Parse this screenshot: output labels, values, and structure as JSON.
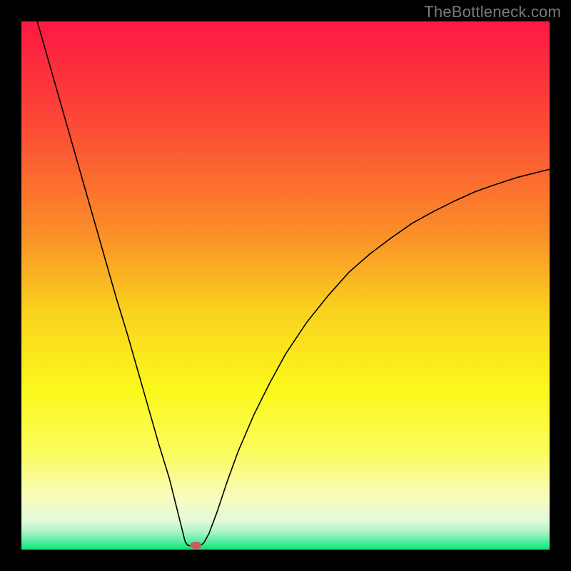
{
  "watermark": "TheBottleneck.com",
  "chart_data": {
    "type": "line",
    "title": "",
    "xlabel": "",
    "ylabel": "",
    "xlim": [
      0,
      100
    ],
    "ylim": [
      0,
      100
    ],
    "grid": false,
    "legend": false,
    "background_gradient": {
      "stops": [
        {
          "pos": 0.0,
          "color": "#fd1844"
        },
        {
          "pos": 0.2,
          "color": "#fc4b35"
        },
        {
          "pos": 0.4,
          "color": "#fa8e29"
        },
        {
          "pos": 0.55,
          "color": "#fad31e"
        },
        {
          "pos": 0.7,
          "color": "#fbf81c"
        },
        {
          "pos": 0.82,
          "color": "#fbfc61"
        },
        {
          "pos": 0.9,
          "color": "#f8fcbb"
        },
        {
          "pos": 0.945,
          "color": "#e3f9da"
        },
        {
          "pos": 0.965,
          "color": "#b1f5c8"
        },
        {
          "pos": 0.985,
          "color": "#53eea0"
        },
        {
          "pos": 1.0,
          "color": "#08e578"
        }
      ]
    },
    "series": [
      {
        "name": "bottleneck-curve",
        "stroke": "#000000",
        "stroke_width": 1.6,
        "points": [
          {
            "x": 3.0,
            "y": 100.0
          },
          {
            "x": 4.0,
            "y": 96.5
          },
          {
            "x": 6.0,
            "y": 89.5
          },
          {
            "x": 8.0,
            "y": 82.5
          },
          {
            "x": 10.0,
            "y": 75.5
          },
          {
            "x": 12.0,
            "y": 68.5
          },
          {
            "x": 14.0,
            "y": 61.5
          },
          {
            "x": 16.0,
            "y": 54.5
          },
          {
            "x": 18.0,
            "y": 47.5
          },
          {
            "x": 20.0,
            "y": 41.0
          },
          {
            "x": 22.0,
            "y": 34.0
          },
          {
            "x": 24.0,
            "y": 27.0
          },
          {
            "x": 26.0,
            "y": 20.0
          },
          {
            "x": 28.0,
            "y": 13.5
          },
          {
            "x": 29.5,
            "y": 7.5
          },
          {
            "x": 30.5,
            "y": 3.5
          },
          {
            "x": 31.0,
            "y": 1.5
          },
          {
            "x": 31.5,
            "y": 0.8
          },
          {
            "x": 32.5,
            "y": 0.6
          },
          {
            "x": 33.5,
            "y": 0.6
          },
          {
            "x": 34.5,
            "y": 1.2
          },
          {
            "x": 35.5,
            "y": 3.0
          },
          {
            "x": 37.0,
            "y": 7.0
          },
          {
            "x": 39.0,
            "y": 13.0
          },
          {
            "x": 41.0,
            "y": 18.5
          },
          {
            "x": 44.0,
            "y": 25.5
          },
          {
            "x": 47.0,
            "y": 31.5
          },
          {
            "x": 50.0,
            "y": 37.0
          },
          {
            "x": 54.0,
            "y": 43.0
          },
          {
            "x": 58.0,
            "y": 48.0
          },
          {
            "x": 62.0,
            "y": 52.5
          },
          {
            "x": 66.0,
            "y": 56.0
          },
          {
            "x": 70.0,
            "y": 59.0
          },
          {
            "x": 74.0,
            "y": 61.8
          },
          {
            "x": 78.0,
            "y": 64.0
          },
          {
            "x": 82.0,
            "y": 66.0
          },
          {
            "x": 86.0,
            "y": 67.8
          },
          {
            "x": 90.0,
            "y": 69.2
          },
          {
            "x": 94.0,
            "y": 70.5
          },
          {
            "x": 98.0,
            "y": 71.5
          },
          {
            "x": 100.0,
            "y": 72.0
          }
        ]
      }
    ],
    "marker": {
      "name": "optimal-point",
      "x": 33.0,
      "y": 0.8,
      "color": "#c86058",
      "rx": 1.1,
      "ry": 0.7
    }
  }
}
